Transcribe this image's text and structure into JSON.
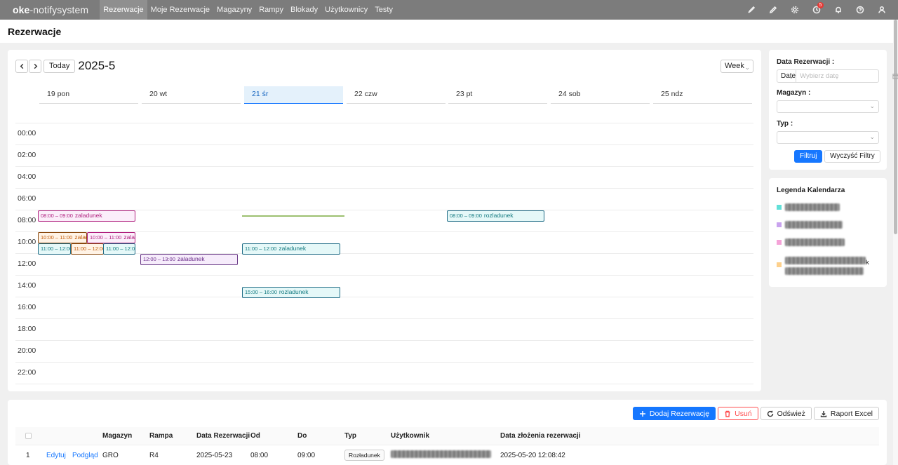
{
  "app": {
    "logo_bold": "oke",
    "logo_rest": "-notifysystem",
    "nav": [
      "Rezerwacje",
      "Moje Rezerwacje",
      "Magazyny",
      "Rampy",
      "Blokady",
      "Użytkownicy",
      "Testy"
    ],
    "notifications_count": "5",
    "top_icons": [
      "brush-icon",
      "edit-icon",
      "settings-icon",
      "pending-icon",
      "bell-icon",
      "help-icon",
      "user-icon"
    ]
  },
  "page": {
    "title": "Rezerwacje"
  },
  "calendar": {
    "today_label": "Today",
    "title": "2025-5",
    "view": "Week",
    "days": [
      "19 pon",
      "20 wt",
      "21 śr",
      "22 czw",
      "23 pt",
      "24 sob",
      "25 ndz"
    ],
    "today_index": 2,
    "times": [
      "00:00",
      "02:00",
      "04:00",
      "06:00",
      "08:00",
      "10:00",
      "12:00",
      "14:00",
      "16:00",
      "18:00",
      "20:00",
      "22:00"
    ],
    "events": [
      {
        "day": 0,
        "time": "08:00 – 09:00",
        "title": "zaladunek",
        "color": "pink"
      },
      {
        "day": 0,
        "time": "10:00 – 11:00",
        "title": "zaladunek",
        "color": "orange"
      },
      {
        "day": 0,
        "time": "10:00 – 11:00",
        "title": "zaladunek",
        "color": "pink"
      },
      {
        "day": 0,
        "time": "11:00 – 12:00",
        "title": "",
        "color": "teal"
      },
      {
        "day": 0,
        "time": "11:00 – 12:00",
        "title": "",
        "color": "orange"
      },
      {
        "day": 0,
        "time": "11:00 – 12:00",
        "title": "",
        "color": "teal"
      },
      {
        "day": 1,
        "time": "12:00 – 13:00",
        "title": "zaladunek",
        "color": "purple"
      },
      {
        "day": 2,
        "time": "11:00 – 12:00",
        "title": "zaladunek",
        "color": "teal"
      },
      {
        "day": 2,
        "time": "15:00 – 16:00",
        "title": "rozladunek",
        "color": "teal"
      },
      {
        "day": 4,
        "time": "08:00 – 09:00",
        "title": "rozladunek",
        "color": "teal"
      }
    ]
  },
  "filters": {
    "date_label": "Data Rezerwacji",
    "date_type": "Date",
    "date_placeholder": "Wybierz datę",
    "warehouse_label": "Magazyn",
    "type_label": "Typ",
    "filter_button": "Filtruj",
    "clear_button": "Wyczyść Filtry"
  },
  "legend": {
    "title": "Legenda Kalendarza",
    "colors": [
      "#62e0d8",
      "#c9a3ee",
      "#f5a3d8",
      "#fdd08c"
    ],
    "visible_suffix_4": "k"
  },
  "table": {
    "actions": {
      "add": "Dodaj Rezerwację",
      "delete": "Usuń",
      "refresh": "Odśwież",
      "report": "Raport Excel"
    },
    "columns": [
      "Magazyn",
      "Rampa",
      "Data Rezerwacji",
      "Od",
      "Do",
      "Typ",
      "Użytkownik",
      "Data złożenia rezerwacji"
    ],
    "rows": [
      {
        "index": "1",
        "edit": "Edytuj",
        "preview": "Podgląd",
        "warehouse": "GRO",
        "ramp": "R4",
        "date": "2025-05-23",
        "from": "08:00",
        "to": "09:00",
        "type": "Rozładunek",
        "submitted": "2025-05-20 12:08:42"
      }
    ]
  }
}
